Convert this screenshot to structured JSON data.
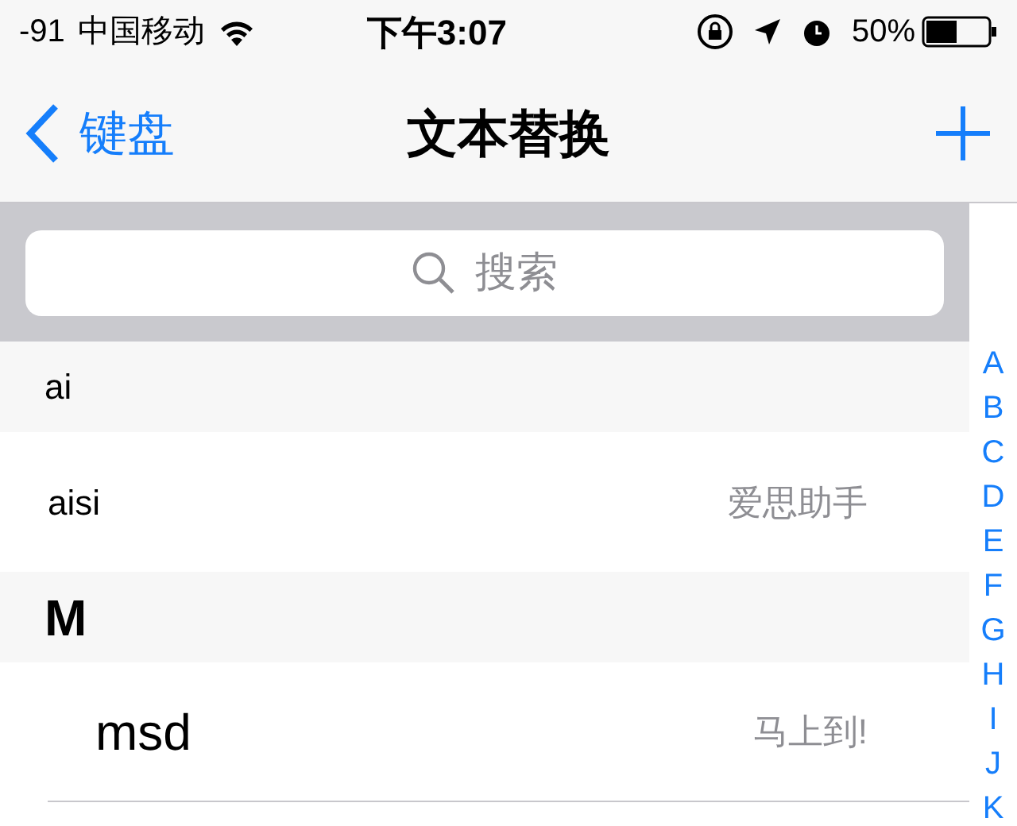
{
  "status_bar": {
    "signal": "-91",
    "carrier": "中国移动",
    "time": "下午3:07",
    "battery": "50%"
  },
  "nav_bar": {
    "back": "键盘",
    "title": "文本替换"
  },
  "search": {
    "placeholder": "搜索"
  },
  "sections": [
    {
      "header": "ai",
      "kind": "compact",
      "rows": [
        {
          "phrase": "aisi",
          "shortcut": "爱思助手",
          "kind": "compact"
        }
      ]
    },
    {
      "header": "M",
      "kind": "regular",
      "rows": [
        {
          "phrase": "msd",
          "shortcut": "马上到!",
          "kind": "regular"
        }
      ]
    }
  ],
  "index": [
    "A",
    "B",
    "C",
    "D",
    "E",
    "F",
    "G",
    "H",
    "I",
    "J",
    "K"
  ]
}
